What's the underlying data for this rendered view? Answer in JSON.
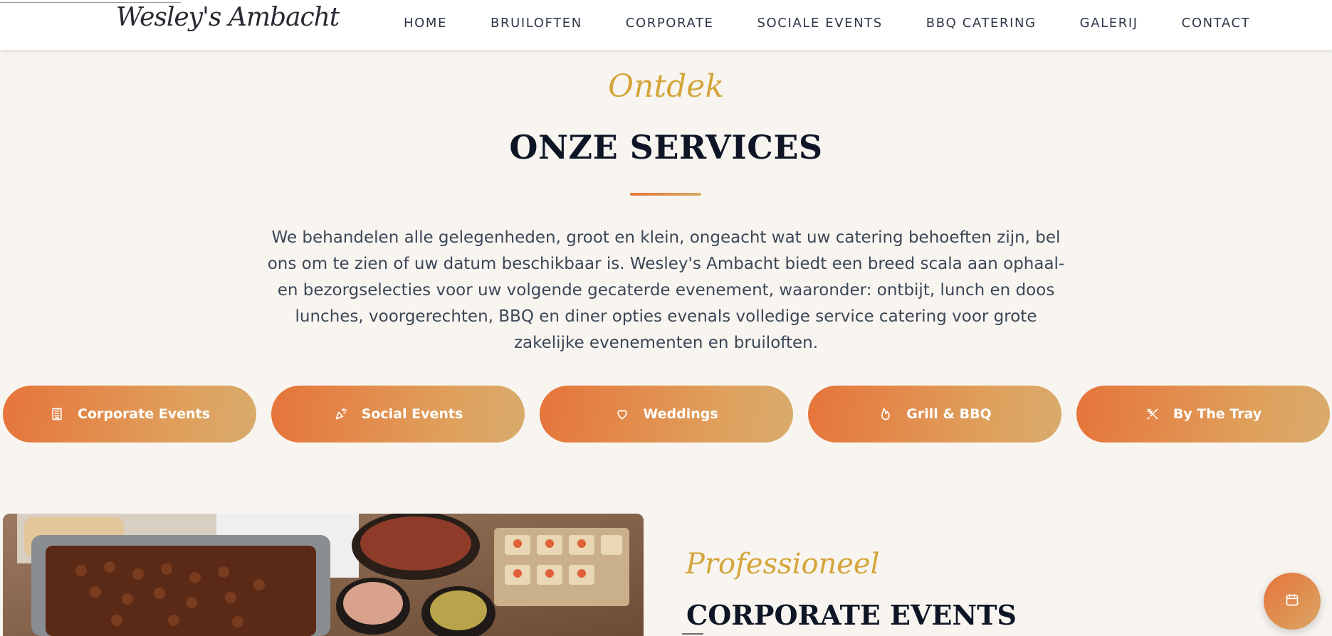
{
  "header": {
    "logo_text": "Wesley's Ambacht",
    "nav": [
      "HOME",
      "BRUILOFTEN",
      "CORPORATE",
      "SOCIALE EVENTS",
      "BBQ CATERING",
      "GALERIJ",
      "CONTACT"
    ]
  },
  "services": {
    "eyebrow": "Ontdek",
    "title": "ONZE SERVICES",
    "intro": "We behandelen alle gelegenheden, groot en klein, ongeacht wat uw catering behoeften zijn, bel ons om te zien of uw datum beschikbaar is. Wesley's Ambacht biedt een breed scala aan ophaal- en bezorgselecties voor uw volgende gecaterde evenement, waaronder: ontbijt, lunch en doos lunches, voorgerechten, BBQ en diner opties evenals volledige service catering voor grote zakelijke evenementen en bruiloften.",
    "pills": [
      {
        "label": "Corporate Events",
        "icon": "building-icon"
      },
      {
        "label": "Social Events",
        "icon": "party-popper-icon"
      },
      {
        "label": "Weddings",
        "icon": "heart-icon"
      },
      {
        "label": "Grill & BBQ",
        "icon": "flame-icon"
      },
      {
        "label": "By The Tray",
        "icon": "utensils-crossed-icon"
      }
    ]
  },
  "corporate": {
    "eyebrow": "Professioneel",
    "title": "CORPORATE EVENTS"
  },
  "fab": {
    "icon": "calendar-icon"
  },
  "colors": {
    "accent_gold": "#d4a53a",
    "accent_orange": "#e6743a",
    "background": "#f8f5f1",
    "heading": "#0e1626"
  }
}
